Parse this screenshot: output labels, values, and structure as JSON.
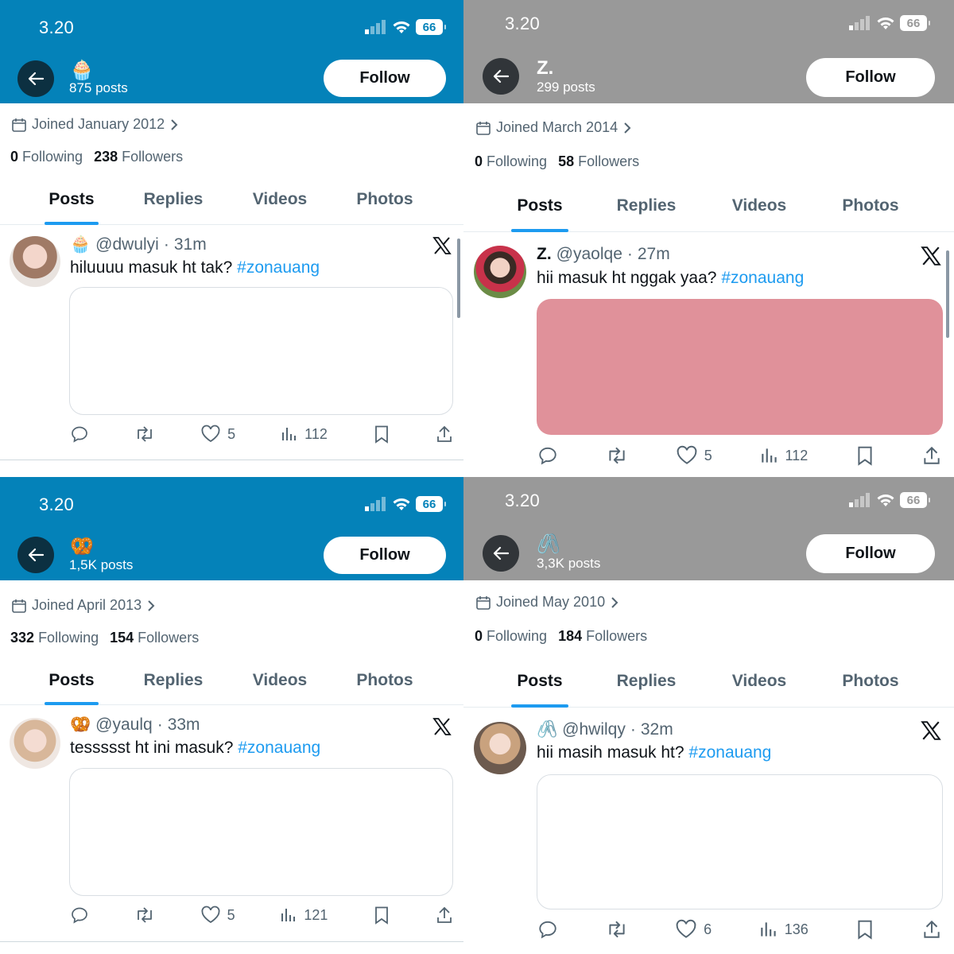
{
  "panels": [
    {
      "header_color": "#0482b9",
      "status": {
        "time": "3.20",
        "battery": "66"
      },
      "profile": {
        "name_emoji": "🧁",
        "name": "",
        "posts": "875 posts",
        "follow_label": "Follow"
      },
      "joined": "Joined January 2012",
      "following_count": "0",
      "following_label": "Following",
      "followers_count": "238",
      "followers_label": "Followers",
      "tabs": [
        "Posts",
        "Replies",
        "Videos",
        "Photos"
      ],
      "tweet": {
        "emoji": "🧁",
        "name": "",
        "handle": "@dwulyi",
        "dot": "·",
        "time": "31m",
        "text": "hiluuuu masuk ht tak?",
        "hashtag": "#zonauang",
        "likes": "5",
        "views": "112",
        "media_color": "#ffffff"
      }
    },
    {
      "header_color": "#999999",
      "status": {
        "time": "3.20",
        "battery": "66"
      },
      "profile": {
        "name_emoji": "",
        "name": "Z.",
        "posts": "299 posts",
        "follow_label": "Follow"
      },
      "joined": "Joined March 2014",
      "following_count": "0",
      "following_label": "Following",
      "followers_count": "58",
      "followers_label": "Followers",
      "tabs": [
        "Posts",
        "Replies",
        "Videos",
        "Photos"
      ],
      "tweet": {
        "emoji": "",
        "name": "Z.",
        "handle": "@yaolqe",
        "dot": "·",
        "time": "27m",
        "text": "hii masuk ht nggak yaa?",
        "hashtag": "#zonauang",
        "likes": "5",
        "views": "112",
        "media_color": "#e0919a"
      }
    },
    {
      "header_color": "#0482b9",
      "status": {
        "time": "3.20",
        "battery": "66"
      },
      "profile": {
        "name_emoji": "🥨",
        "name": "",
        "posts": "1,5K posts",
        "follow_label": "Follow"
      },
      "joined": "Joined April 2013",
      "following_count": "332",
      "following_label": "Following",
      "followers_count": "154",
      "followers_label": "Followers",
      "tabs": [
        "Posts",
        "Replies",
        "Videos",
        "Photos"
      ],
      "tweet": {
        "emoji": "🥨",
        "name": "",
        "handle": "@yaulq",
        "dot": "·",
        "time": "33m",
        "text": "tessssst ht ini masuk?",
        "hashtag": "#zonauang",
        "likes": "5",
        "views": "121",
        "media_color": "#ffffff"
      }
    },
    {
      "header_color": "#999999",
      "status": {
        "time": "3.20",
        "battery": "66"
      },
      "profile": {
        "name_emoji": "🖇️",
        "name": "",
        "posts": "3,3K posts",
        "follow_label": "Follow"
      },
      "joined": "Joined May 2010",
      "following_count": "0",
      "following_label": "Following",
      "followers_count": "184",
      "followers_label": "Followers",
      "tabs": [
        "Posts",
        "Replies",
        "Videos",
        "Photos"
      ],
      "tweet": {
        "emoji": "🖇️",
        "name": "",
        "handle": "@hwilqy",
        "dot": "·",
        "time": "32m",
        "text": "hii masih masuk ht?",
        "hashtag": "#zonauang",
        "likes": "6",
        "views": "136",
        "media_color": "#ffffff"
      }
    }
  ]
}
